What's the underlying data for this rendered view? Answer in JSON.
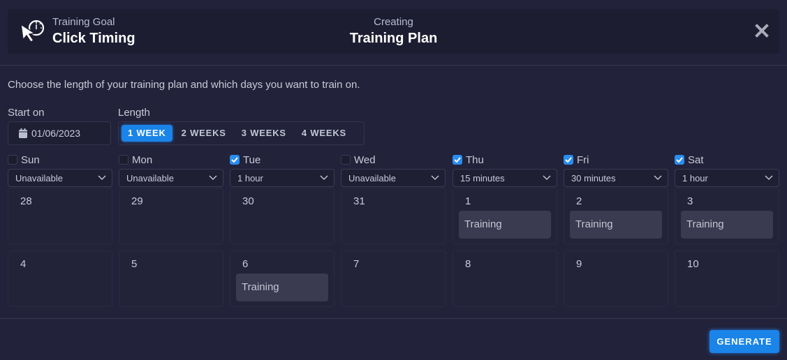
{
  "header": {
    "goal_label": "Training Goal",
    "goal_value": "Click Timing",
    "center_label": "Creating",
    "center_value": "Training Plan",
    "goal_icon": "cursor-stopwatch-icon",
    "close_icon": "close-icon"
  },
  "instructions": "Choose the length of your training plan and which days you want to train on.",
  "start": {
    "label": "Start on",
    "value": "01/06/2023",
    "icon": "calendar-icon"
  },
  "length": {
    "label": "Length",
    "options": [
      "1 WEEK",
      "2 WEEKS",
      "3 WEEKS",
      "4 WEEKS"
    ],
    "selected": "1 WEEK"
  },
  "days": [
    {
      "name": "Sun",
      "checked": false,
      "duration": "Unavailable"
    },
    {
      "name": "Mon",
      "checked": false,
      "duration": "Unavailable"
    },
    {
      "name": "Tue",
      "checked": true,
      "duration": "1 hour"
    },
    {
      "name": "Wed",
      "checked": false,
      "duration": "Unavailable"
    },
    {
      "name": "Thu",
      "checked": true,
      "duration": "15 minutes"
    },
    {
      "name": "Fri",
      "checked": true,
      "duration": "30 minutes"
    },
    {
      "name": "Sat",
      "checked": true,
      "duration": "1 hour"
    }
  ],
  "calendar": {
    "weeks": [
      [
        {
          "day": "28",
          "event": null
        },
        {
          "day": "29",
          "event": null
        },
        {
          "day": "30",
          "event": null
        },
        {
          "day": "31",
          "event": null
        },
        {
          "day": "1",
          "event": "Training"
        },
        {
          "day": "2",
          "event": "Training"
        },
        {
          "day": "3",
          "event": "Training"
        }
      ],
      [
        {
          "day": "4",
          "event": null
        },
        {
          "day": "5",
          "event": null
        },
        {
          "day": "6",
          "event": "Training"
        },
        {
          "day": "7",
          "event": null
        },
        {
          "day": "8",
          "event": null
        },
        {
          "day": "9",
          "event": null
        },
        {
          "day": "10",
          "event": null
        }
      ]
    ]
  },
  "footer": {
    "generate_label": "GENERATE"
  },
  "colors": {
    "accent": "#1a84e8",
    "background": "#22223a",
    "header_bg": "#1d1d32",
    "event_bg": "#3a3a50"
  }
}
